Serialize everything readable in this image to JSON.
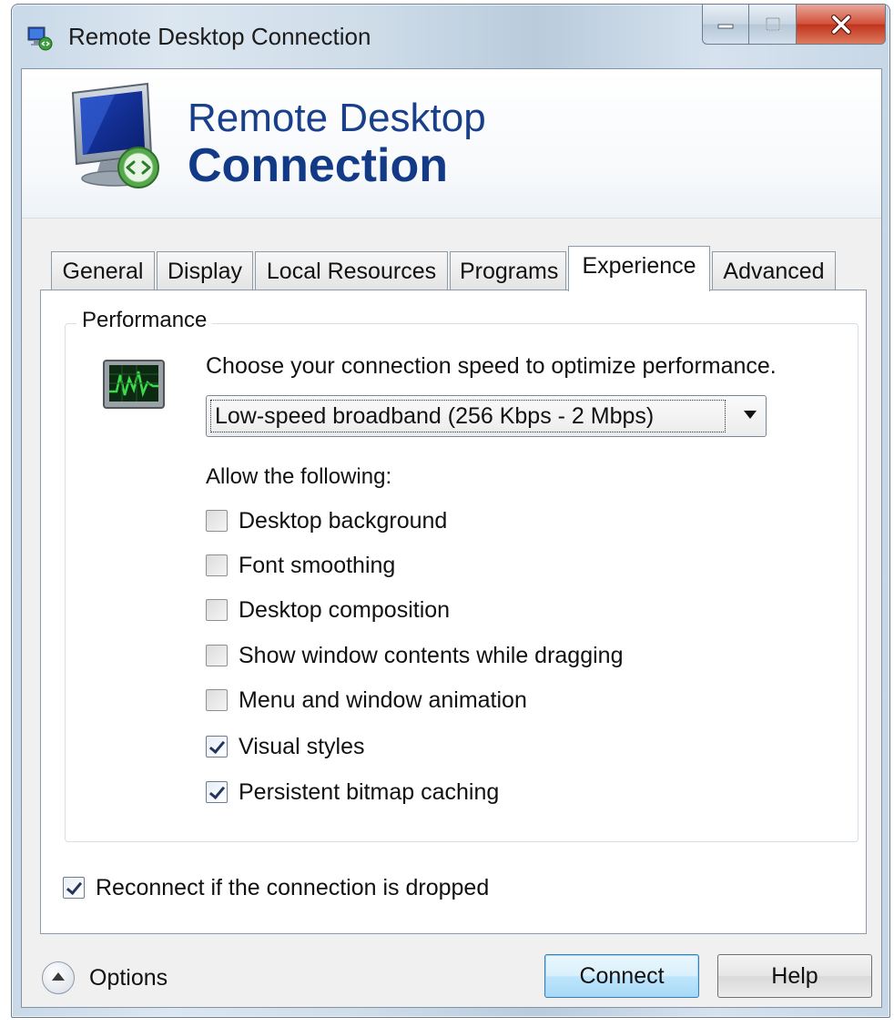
{
  "window": {
    "title": "Remote Desktop Connection"
  },
  "banner": {
    "line1": "Remote Desktop",
    "line2": "Connection"
  },
  "tabs": [
    {
      "label": "General",
      "active": false
    },
    {
      "label": "Display",
      "active": false
    },
    {
      "label": "Local Resources",
      "active": false
    },
    {
      "label": "Programs",
      "active": false
    },
    {
      "label": "Experience",
      "active": true
    },
    {
      "label": "Advanced",
      "active": false
    }
  ],
  "performance": {
    "group_label": "Performance",
    "choose_text": "Choose your connection speed to optimize performance.",
    "speed_value": "Low-speed broadband (256 Kbps - 2 Mbps)",
    "allow_label": "Allow the following:",
    "options": [
      {
        "label": "Desktop background",
        "checked": false
      },
      {
        "label": "Font smoothing",
        "checked": false
      },
      {
        "label": "Desktop composition",
        "checked": false
      },
      {
        "label": "Show window contents while dragging",
        "checked": false
      },
      {
        "label": "Menu and window animation",
        "checked": false
      },
      {
        "label": "Visual styles",
        "checked": true
      },
      {
        "label": "Persistent bitmap caching",
        "checked": true
      }
    ]
  },
  "reconnect": {
    "label": "Reconnect if the connection is dropped",
    "checked": true
  },
  "footer": {
    "options_label": "Options",
    "connect_label": "Connect",
    "help_label": "Help"
  },
  "colors": {
    "banner_text": "#1a3f8a",
    "close_button": "#c0331c",
    "connect_button": "#bee6fd"
  }
}
